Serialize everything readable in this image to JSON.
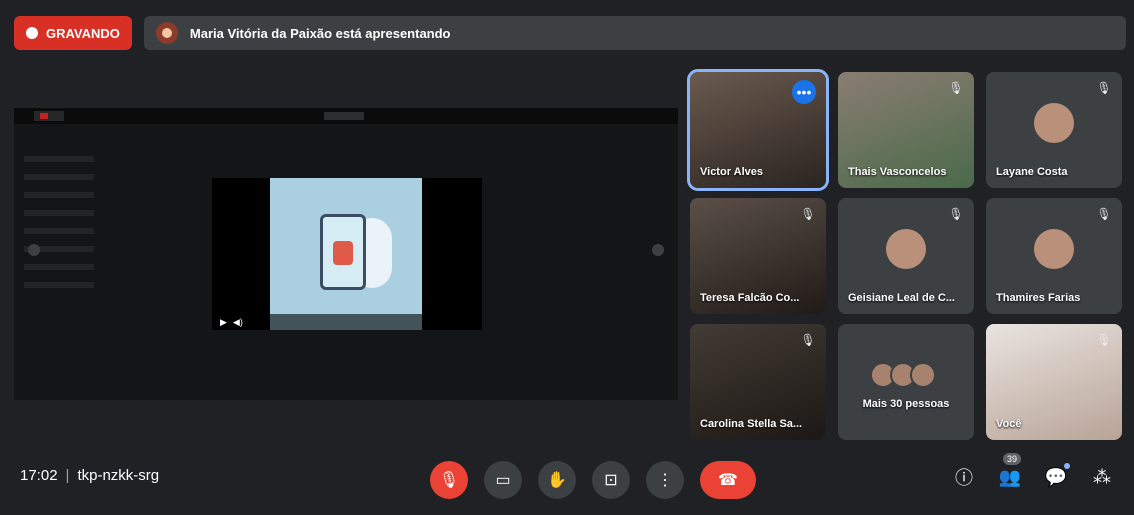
{
  "recording": {
    "label": "GRAVANDO"
  },
  "presenting": {
    "text": "Maria Vitória da Paixão está apresentando"
  },
  "participants": [
    {
      "name": "Victor Alves",
      "active": true
    },
    {
      "name": "Thais Vasconcelos"
    },
    {
      "name": "Layane Costa"
    },
    {
      "name": "Teresa Falcão Co..."
    },
    {
      "name": "Geisiane Leal de C..."
    },
    {
      "name": "Thamires Farias"
    },
    {
      "name": "Carolina Stella Sa..."
    },
    {
      "name": "Mais 30 pessoas"
    },
    {
      "name": "Você"
    }
  ],
  "footer": {
    "time": "17:02",
    "meeting_code": "tkp-nzkk-srg",
    "people_count": "39"
  },
  "icons": {
    "mic_off": "mic-off-icon",
    "camera": "camera-icon",
    "raise_hand": "raise-hand-icon",
    "present": "present-icon",
    "more": "more-options-icon",
    "hangup": "hangup-icon",
    "info": "info-icon",
    "people": "people-icon",
    "chat": "chat-icon",
    "activities": "activities-icon"
  },
  "colors": {
    "recording": "#d93025",
    "hangup": "#ea4335",
    "active_speaker": "#8ab4f8",
    "background": "#202124"
  }
}
